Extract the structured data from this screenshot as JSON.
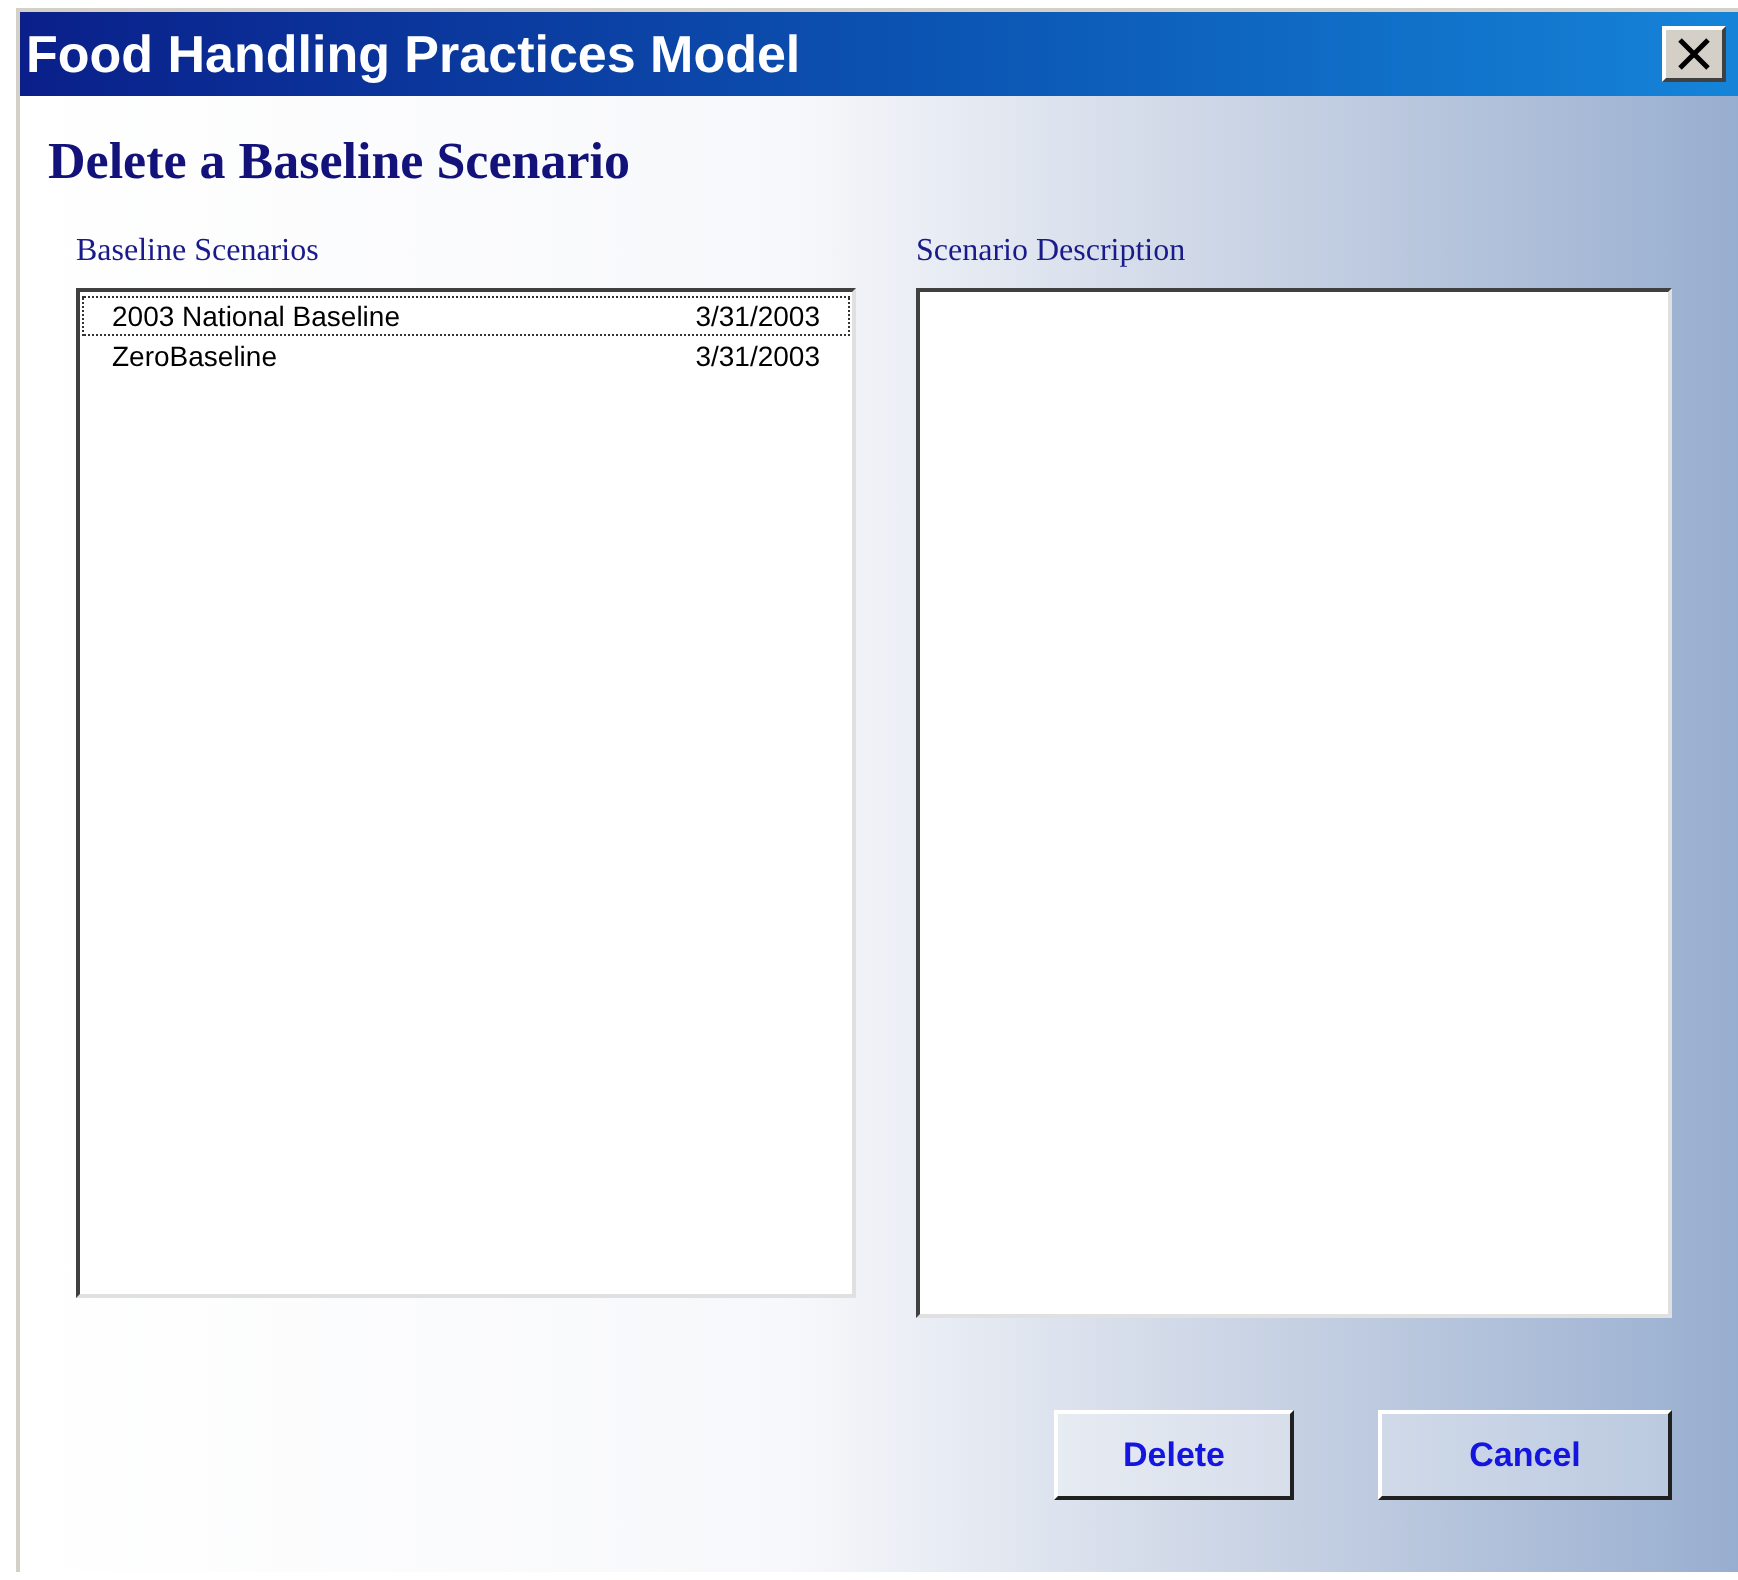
{
  "window": {
    "title": "Food Handling Practices Model"
  },
  "heading": "Delete a Baseline Scenario",
  "scenarios": {
    "label": "Baseline Scenarios",
    "items": [
      {
        "name": "2003 National Baseline",
        "date": "3/31/2003",
        "focused": true
      },
      {
        "name": "ZeroBaseline",
        "date": "3/31/2003",
        "focused": false
      }
    ]
  },
  "description": {
    "label": "Scenario Description"
  },
  "buttons": [
    {
      "label": "Delete"
    },
    {
      "label": "Cancel"
    }
  ]
}
